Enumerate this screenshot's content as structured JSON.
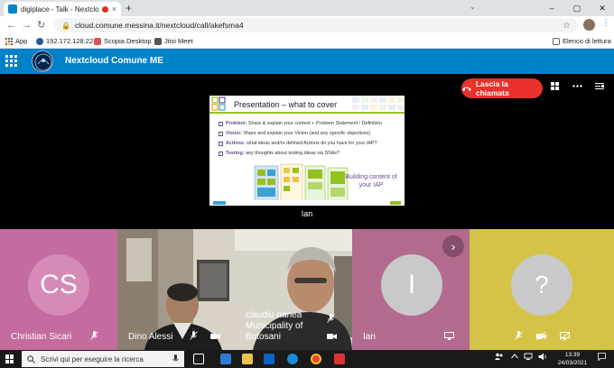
{
  "browser": {
    "tab_title": "digiplace - Talk - Nextcloud",
    "tab_close": "×",
    "new_tab": "+",
    "tab_search": "⌄",
    "url": "cloud.comune.messina.it/nextcloud/call/akefsma4",
    "window_controls": {
      "minimize": "–",
      "maximize": "▢",
      "close": "✕"
    },
    "nav": {
      "back": "←",
      "forward": "→",
      "reload": "↻"
    },
    "lock_icon": "🔒",
    "star_icon": "☆",
    "menu_icon": "⋮"
  },
  "bookmarks": {
    "apps_label": "App",
    "items": [
      {
        "label": "192.172.128.22",
        "color": "#2b5797"
      },
      {
        "label": "Scopia Desktop",
        "color": "#d9534f"
      },
      {
        "label": "Jitsi Meet",
        "color": "#555555"
      }
    ],
    "reading_list": "Elenco di lettura"
  },
  "nextcloud": {
    "title": "Nextcloud Comune ME",
    "brand_color": "#0082c9"
  },
  "call": {
    "leave_button": "Lascia la chiamata",
    "leave_icon": "phone-hangup-icon",
    "top_icons": [
      "grid-view-icon",
      "more-icon",
      "sidebar-toggle-icon"
    ],
    "screen_share": {
      "title": "Presentation – what to cover",
      "bullets": [
        {
          "key": "Problem:",
          "text": "Share & explain your context + Problem Statement / Definition"
        },
        {
          "key": "Vision:",
          "text": "Share and explain your Vision (and any specific objectives)"
        },
        {
          "key": "Actions:",
          "text": "what ideas and/or defined Actions do you have for your IAP?"
        },
        {
          "key": "Testing:",
          "text": "any thoughts about testing ideas via SSAs?"
        }
      ],
      "building_text": "Building content of your IAP",
      "presenter": "Ian"
    },
    "participants": [
      {
        "name": "Christian Sicari",
        "initials": "CS",
        "bg": "#c46ba0",
        "circle": "#d58ab8",
        "muted": true
      },
      {
        "name": "Dino Alessi",
        "bg": "#6b6056",
        "muted": true,
        "camera": true
      },
      {
        "name": "claudiu nanea Municipality of Botosani",
        "bg": "#4a4640",
        "muted": true,
        "camera": true
      },
      {
        "name": "Ian",
        "initials": "I",
        "bg": "#b26a8e",
        "circle": "#c9c9c9",
        "screenshare": true
      },
      {
        "name": "",
        "initials": "?",
        "bg": "#d4c346",
        "circle": "#c9c9c9",
        "muted": true,
        "video_off": true
      }
    ],
    "next_arrow": "›"
  },
  "taskbar": {
    "search_placeholder": "Scrivi qui per eseguire la ricerca",
    "time": "13:39",
    "date": "24/03/2021"
  }
}
